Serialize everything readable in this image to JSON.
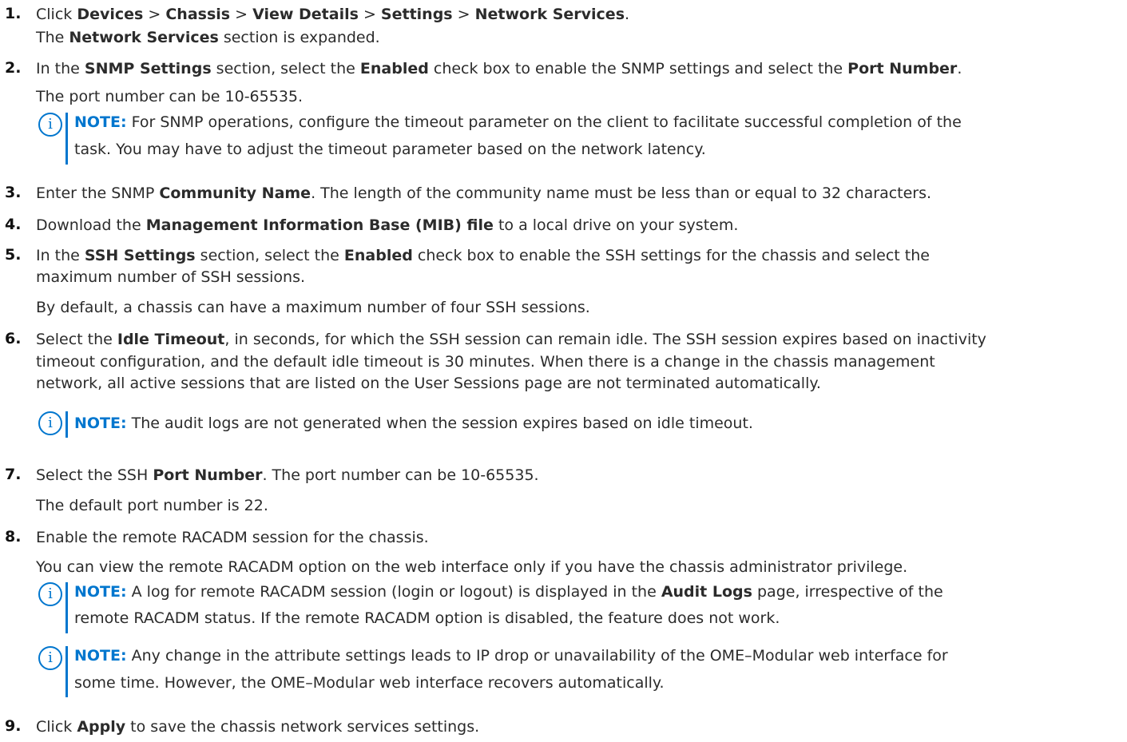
{
  "steps": [
    {
      "num": "1.",
      "lines": [
        {
          "parts": [
            "Click ",
            "Devices",
            " > ",
            "Chassis",
            " > ",
            "View Details",
            " > ",
            "Settings",
            " > ",
            "Network Services",
            "."
          ]
        },
        {
          "parts": [
            "The ",
            "Network Services",
            " section is expanded."
          ]
        }
      ]
    },
    {
      "num": "2.",
      "lines": [
        {
          "parts": [
            "In the ",
            "SNMP Settings",
            " section, select the ",
            "Enabled",
            " check box to enable the SNMP settings and select the ",
            "Port Number",
            "."
          ]
        },
        {
          "parts": [
            "The port number can be 10-65535."
          ]
        }
      ],
      "note": {
        "label": "NOTE:",
        "lines": [
          {
            "parts": [
              " For SNMP operations, configure the timeout parameter on the client to facilitate successful completion of the"
            ]
          },
          {
            "parts": [
              "task. You may have to adjust the timeout parameter based on the network latency."
            ]
          }
        ]
      }
    },
    {
      "num": "3.",
      "lines": [
        {
          "parts": [
            "Enter the SNMP ",
            "Community Name",
            ". The length of the community name must be less than or equal to 32 characters."
          ]
        }
      ]
    },
    {
      "num": "4.",
      "lines": [
        {
          "parts": [
            "Download the ",
            "Management Information Base (MIB) file",
            " to a local drive on your system."
          ]
        }
      ]
    },
    {
      "num": "5.",
      "lines": [
        {
          "parts": [
            "In the ",
            "SSH Settings",
            " section, select the ",
            "Enabled",
            " check box to enable the SSH settings for the chassis and select the"
          ]
        },
        {
          "parts": [
            "maximum number of SSH sessions."
          ]
        },
        {
          "parts": [
            "By default, a chassis can have a maximum number of four SSH sessions."
          ]
        }
      ]
    },
    {
      "num": "6.",
      "lines": [
        {
          "parts": [
            "Select the ",
            "Idle Timeout",
            ", in seconds, for which the SSH session can remain idle. The SSH session expires based on inactivity"
          ]
        },
        {
          "parts": [
            "timeout configuration, and the default idle timeout is 30 minutes. When there is a change in the chassis management"
          ]
        },
        {
          "parts": [
            "network, all active sessions that are listed on the User Sessions page are not terminated automatically."
          ]
        }
      ],
      "note": {
        "label": "NOTE:",
        "lines": [
          {
            "parts": [
              " The audit logs are not generated when the session expires based on idle timeout."
            ]
          }
        ]
      }
    },
    {
      "num": "7.",
      "lines": [
        {
          "parts": [
            "Select the SSH ",
            "Port Number",
            ". The port number can be 10-65535."
          ]
        },
        {
          "parts": [
            "The default port number is 22."
          ]
        }
      ]
    },
    {
      "num": "8.",
      "lines": [
        {
          "parts": [
            "Enable the remote RACADM session for the chassis."
          ]
        },
        {
          "parts": [
            "You can view the remote RACADM option on the web interface only if you have the chassis administrator privilege."
          ]
        }
      ],
      "notes": [
        {
          "label": "NOTE:",
          "lines": [
            {
              "parts": [
                " A log for remote RACADM session (login or logout) is displayed in the ",
                "Audit Logs",
                " page, irrespective of the"
              ]
            },
            {
              "parts": [
                "remote RACADM status. If the remote RACADM option is disabled, the feature does not work."
              ]
            }
          ]
        },
        {
          "label": "NOTE:",
          "lines": [
            {
              "parts": [
                " Any change in the attribute settings leads to IP drop or unavailability of the OME–Modular web interface for"
              ]
            },
            {
              "parts": [
                "some time. However, the OME–Modular web interface recovers automatically."
              ]
            }
          ]
        }
      ]
    },
    {
      "num": "9.",
      "lines": [
        {
          "parts": [
            "Click ",
            "Apply",
            " to save the chassis network services settings."
          ]
        }
      ]
    }
  ],
  "icons": {
    "note": "info-circle-icon",
    "note_glyph": "i"
  },
  "colors": {
    "accent": "#0076ce",
    "text": "#2b2b2b"
  }
}
